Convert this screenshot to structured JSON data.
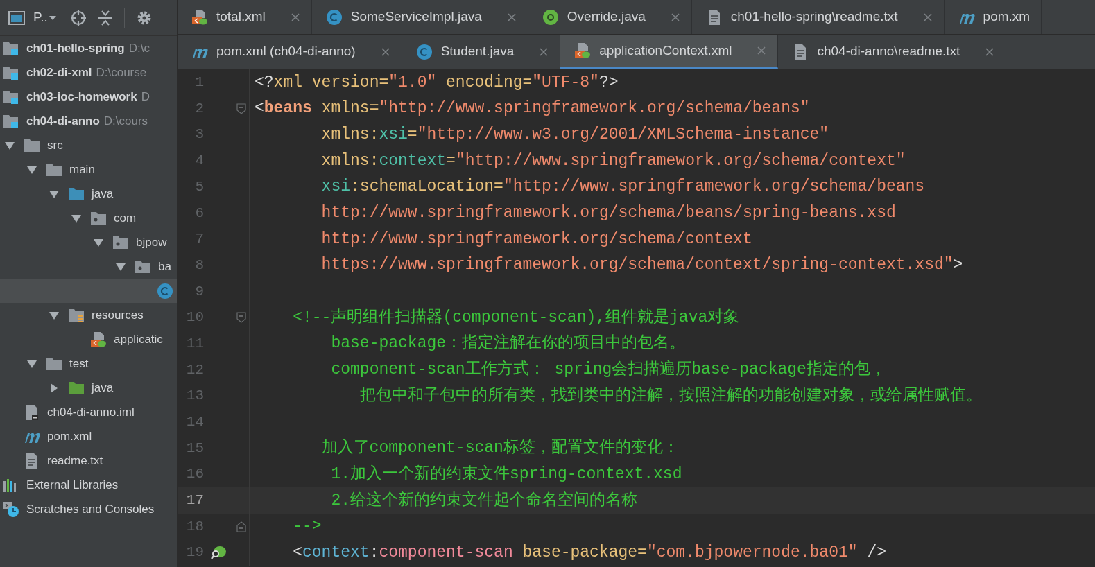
{
  "toolbar": {
    "project_label": "P.."
  },
  "sidebar": {
    "items": [
      {
        "kind": "module",
        "label": "ch01-hello-spring",
        "path": "D:\\c",
        "selected": false
      },
      {
        "kind": "module",
        "label": "ch02-di-xml",
        "path": "D:\\course",
        "selected": false
      },
      {
        "kind": "module",
        "label": "ch03-ioc-homework",
        "path": "D",
        "selected": false
      },
      {
        "kind": "module",
        "label": "ch04-di-anno",
        "path": "D:\\cours",
        "selected": false,
        "children": [
          {
            "kind": "folder",
            "label": "src",
            "expanded": true,
            "selected": false,
            "children": [
              {
                "kind": "folder",
                "label": "main",
                "expanded": true,
                "selected": false,
                "children": [
                  {
                    "kind": "source-folder",
                    "label": "java",
                    "expanded": true,
                    "selected": false,
                    "children": [
                      {
                        "kind": "package",
                        "label": "com",
                        "expanded": true,
                        "selected": false,
                        "children": [
                          {
                            "kind": "package",
                            "label": "bjpow",
                            "expanded": true,
                            "selected": false,
                            "children": [
                              {
                                "kind": "package",
                                "label": "ba",
                                "expanded": true,
                                "selected": false,
                                "children": [
                                  {
                                    "kind": "class",
                                    "selected": true
                                  }
                                ]
                              }
                            ]
                          }
                        ]
                      }
                    ]
                  },
                  {
                    "kind": "resource-folder",
                    "label": "resources",
                    "expanded": true,
                    "selected": false,
                    "children": [
                      {
                        "kind": "spring-xml",
                        "label": "applicatic",
                        "selected": false
                      }
                    ]
                  }
                ]
              },
              {
                "kind": "folder",
                "label": "test",
                "expanded": true,
                "selected": false,
                "children": [
                  {
                    "kind": "test-folder",
                    "label": "java",
                    "expanded": false,
                    "selected": false
                  }
                ]
              }
            ]
          },
          {
            "kind": "iml",
            "label": "ch04-di-anno.iml",
            "selected": false
          },
          {
            "kind": "maven",
            "label": "pom.xml",
            "selected": false
          },
          {
            "kind": "text",
            "label": "readme.txt",
            "selected": false
          }
        ]
      },
      {
        "kind": "libraries",
        "label": "External Libraries",
        "selected": false
      },
      {
        "kind": "scratches",
        "label": "Scratches and Consoles",
        "selected": false
      }
    ]
  },
  "tabs_row_1": [
    {
      "kind": "spring-xml",
      "label": "total.xml",
      "selected": false,
      "closable": true
    },
    {
      "kind": "class",
      "label": "SomeServiceImpl.java",
      "selected": false,
      "closable": true
    },
    {
      "kind": "annotation",
      "label": "Override.java",
      "selected": false,
      "closable": true
    },
    {
      "kind": "text",
      "label": "ch01-hello-spring\\readme.txt",
      "selected": false,
      "closable": true
    },
    {
      "kind": "maven",
      "label": "pom.xm",
      "selected": false,
      "closable": false
    }
  ],
  "tabs_row_2": [
    {
      "kind": "maven",
      "label": "pom.xml (ch04-di-anno)",
      "selected": false,
      "closable": true
    },
    {
      "kind": "class",
      "label": "Student.java",
      "selected": false,
      "closable": true
    },
    {
      "kind": "spring-xml",
      "label": "applicationContext.xml",
      "selected": true,
      "closable": true
    },
    {
      "kind": "text",
      "label": "ch04-di-anno\\readme.txt",
      "selected": false,
      "closable": true
    }
  ],
  "editor": {
    "lines": [
      {
        "number": "1",
        "current": false,
        "segments": [
          {
            "kind": "punct",
            "text": "<?"
          },
          {
            "kind": "attr",
            "text": "xml version="
          },
          {
            "kind": "value",
            "text": "\"1.0\""
          },
          {
            "kind": "attr",
            "text": " encoding="
          },
          {
            "kind": "value",
            "text": "\"UTF-8\""
          },
          {
            "kind": "punct",
            "text": "?>"
          }
        ]
      },
      {
        "number": "2",
        "current": false,
        "fold_start": true,
        "segments": [
          {
            "kind": "punct",
            "text": "<"
          },
          {
            "kind": "tag",
            "text": "beans"
          },
          {
            "kind": "attr",
            "text": " xmlns="
          },
          {
            "kind": "value",
            "text": "\"http://www.springframework.org/schema/beans\""
          }
        ]
      },
      {
        "number": "3",
        "current": false,
        "segments": [
          {
            "kind": "attr",
            "text": "       xmlns:"
          },
          {
            "kind": "ns",
            "text": "xsi"
          },
          {
            "kind": "attr",
            "text": "="
          },
          {
            "kind": "value",
            "text": "\"http://www.w3.org/2001/XMLSchema-instance\""
          }
        ]
      },
      {
        "number": "4",
        "current": false,
        "segments": [
          {
            "kind": "attr",
            "text": "       xmlns:"
          },
          {
            "kind": "ns",
            "text": "context"
          },
          {
            "kind": "attr",
            "text": "="
          },
          {
            "kind": "value",
            "text": "\"http://www.springframework.org/schema/context\""
          }
        ]
      },
      {
        "number": "5",
        "current": false,
        "segments": [
          {
            "kind": "ns",
            "text": "       xsi"
          },
          {
            "kind": "attr",
            "text": ":schemaLocation="
          },
          {
            "kind": "value",
            "text": "\"http://www.springframework.org/schema/beans"
          }
        ]
      },
      {
        "number": "6",
        "current": false,
        "segments": [
          {
            "kind": "value",
            "text": "       http://www.springframework.org/schema/beans/spring-beans.xsd"
          }
        ]
      },
      {
        "number": "7",
        "current": false,
        "segments": [
          {
            "kind": "value",
            "text": "       http://www.springframework.org/schema/context"
          }
        ]
      },
      {
        "number": "8",
        "current": false,
        "segments": [
          {
            "kind": "value",
            "text": "       https://www.springframework.org/schema/context/spring-context.xsd\""
          },
          {
            "kind": "punct",
            "text": ">"
          }
        ]
      },
      {
        "number": "9",
        "current": false
      },
      {
        "number": "10",
        "current": false,
        "fold_start": true,
        "segments": [
          {
            "kind": "comment",
            "text": "    <!--声明组件扫描器(component-scan),组件就是java对象"
          }
        ]
      },
      {
        "number": "11",
        "current": false,
        "segments": [
          {
            "kind": "comment",
            "text": "        base-package：指定注解在你的项目中的包名。"
          }
        ]
      },
      {
        "number": "12",
        "current": false,
        "segments": [
          {
            "kind": "comment",
            "text": "        component-scan工作方式： spring会扫描遍历base-package指定的包，"
          }
        ]
      },
      {
        "number": "13",
        "current": false,
        "segments": [
          {
            "kind": "comment",
            "text": "           把包中和子包中的所有类，找到类中的注解，按照注解的功能创建对象，或给属性赋值。"
          }
        ]
      },
      {
        "number": "14",
        "current": false
      },
      {
        "number": "15",
        "current": false,
        "segments": [
          {
            "kind": "comment",
            "text": "       加入了component-scan标签，配置文件的变化："
          }
        ]
      },
      {
        "number": "16",
        "current": false,
        "segments": [
          {
            "kind": "comment",
            "text": "        1.加入一个新的约束文件spring-context.xsd"
          }
        ]
      },
      {
        "number": "17",
        "current": true,
        "segments": [
          {
            "kind": "comment",
            "text": "        2.给这个新的约束文件起个命名空间的名称"
          }
        ]
      },
      {
        "number": "18",
        "current": false,
        "fold_end": true,
        "segments": [
          {
            "kind": "comment",
            "text": "    -->"
          }
        ]
      },
      {
        "number": "19",
        "current": false,
        "bean_marker": true,
        "segments": [
          {
            "kind": "punct",
            "text": "    <"
          },
          {
            "kind": "ns2",
            "text": "context"
          },
          {
            "kind": "punct",
            "text": ":"
          },
          {
            "kind": "tag2",
            "text": "component-scan"
          },
          {
            "kind": "attr",
            "text": " base-package="
          },
          {
            "kind": "value",
            "text": "\"com.bjpowernode.ba01\""
          },
          {
            "kind": "punct",
            "text": " />"
          }
        ]
      }
    ]
  }
}
